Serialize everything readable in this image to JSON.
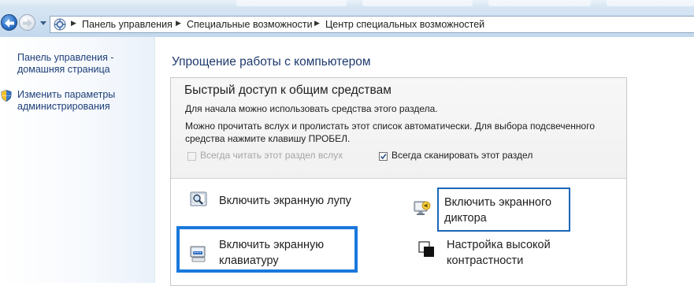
{
  "addressbar": {
    "crumbs": [
      "Панель управления",
      "Специальные возможности",
      "Центр специальных возможностей"
    ],
    "icon": "control-panel-icon"
  },
  "left_pane": {
    "home_link": "Панель управления - домашняя страница",
    "admin_link": "Изменить параметры администрирования"
  },
  "main": {
    "heading": "Упрощение работы с компьютером",
    "quick_access": {
      "title": "Быстрый доступ к общим средствам",
      "intro": "Для начала можно использовать средства этого раздела.",
      "info_line1": "Можно прочитать вслух и пролистать этот список автоматически. Для выбора подсвеченного",
      "info_line2": "средства нажмите клавишу ПРОБЕЛ.",
      "read_aloud": {
        "label": "Всегда читать этот раздел вслух",
        "checked": false,
        "enabled": false
      },
      "scan": {
        "label": "Всегда сканировать этот раздел",
        "checked": true,
        "enabled": true
      }
    },
    "options": {
      "magnifier": {
        "label": "Включить экранную лупу",
        "icon": "magnifier-icon"
      },
      "narrator": {
        "label": "Включить экранного диктора",
        "icon": "narrator-icon"
      },
      "keyboard": {
        "label": "Включить экранную клавиатуру",
        "icon": "keyboard-icon"
      },
      "contrast": {
        "label": "Настройка высокой контрастности",
        "icon": "high-contrast-icon"
      }
    }
  },
  "colors": {
    "link": "#1d3f78",
    "heading": "#1e3a6e",
    "focus_primary": "#1a78dd",
    "focus_secondary": "#1b66b9"
  }
}
